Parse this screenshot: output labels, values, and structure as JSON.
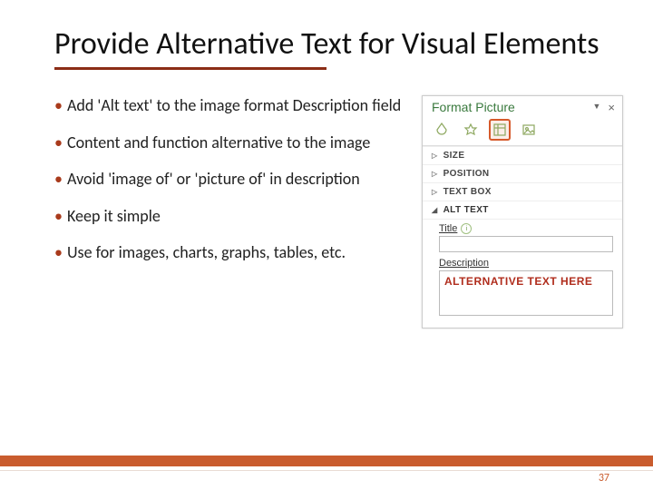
{
  "title": "Provide Alternative Text for Visual Elements",
  "bullets": [
    "Add 'Alt text' to the image format Description field",
    "Content and function alternative to the image",
    "Avoid 'image of' or 'picture of' in description",
    "Keep it simple",
    "Use for images, charts, graphs, tables, etc."
  ],
  "panel": {
    "title": "Format Picture",
    "properties": [
      {
        "label": "SIZE",
        "expanded": false
      },
      {
        "label": "POSITION",
        "expanded": false
      },
      {
        "label": "TEXT BOX",
        "expanded": false
      },
      {
        "label": "ALT TEXT",
        "expanded": true
      }
    ],
    "altText": {
      "titleLabel": "Title",
      "titleValue": "",
      "descLabel": "Description",
      "descValue": "ALTERNATIVE TEXT HERE"
    }
  },
  "pageNumber": "37"
}
